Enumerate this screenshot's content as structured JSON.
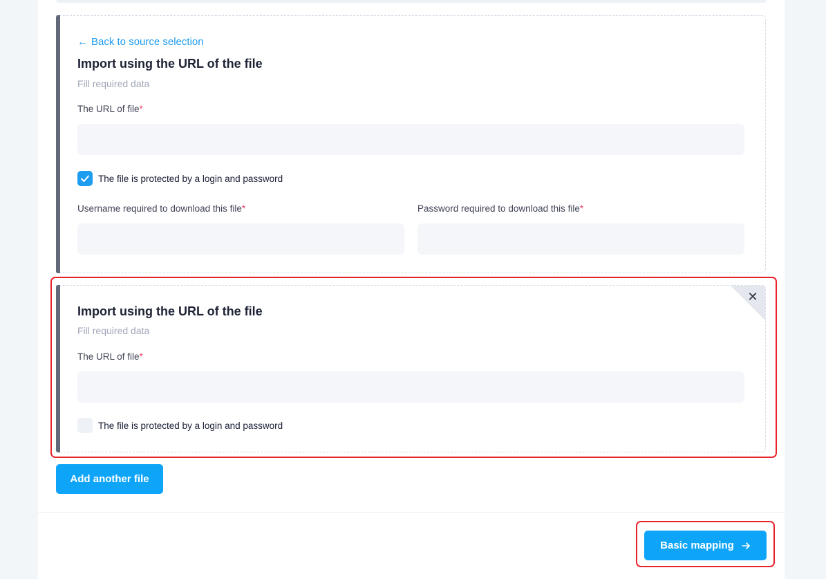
{
  "card1": {
    "back_link": "Back to source selection",
    "title": "Import using the URL of the file",
    "subtitle": "Fill required data",
    "url_label": "The URL of file",
    "url_value": "",
    "protected_label": "The file is protected by a login and password",
    "protected_checked": true,
    "username_label": "Username required to download this file",
    "username_value": "",
    "password_label": "Password required to download this file",
    "password_value": "",
    "required_mark": "*"
  },
  "card2": {
    "title": "Import using the URL of the file",
    "subtitle": "Fill required data",
    "url_label": "The URL of file",
    "url_value": "",
    "protected_label": "The file is protected by a login and password",
    "protected_checked": false,
    "required_mark": "*"
  },
  "buttons": {
    "add_file": "Add another file",
    "basic_mapping": "Basic mapping"
  },
  "icons": {
    "back": "arrow-left-icon",
    "close": "close-icon",
    "check": "checkmark-icon",
    "next": "arrow-right-icon"
  },
  "colors": {
    "accent": "#0ea5f8",
    "highlight": "#e8232a",
    "required": "#f1416c"
  }
}
